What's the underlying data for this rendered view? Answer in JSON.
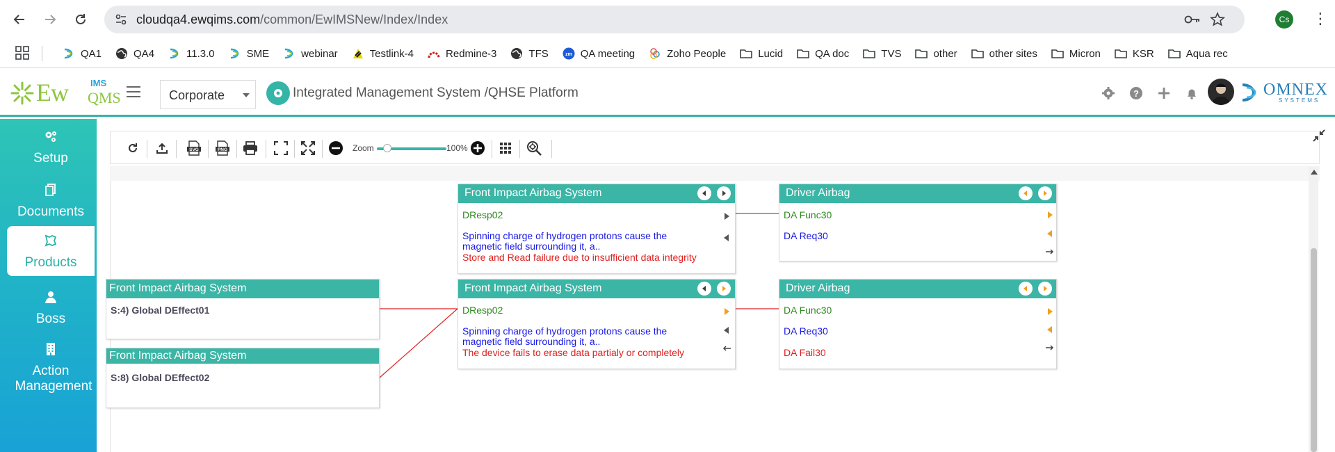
{
  "browser": {
    "url_host": "cloudqa4.ewqims.com",
    "url_path": "/common/EwIMSNew/Index/Index",
    "profile_initials": "Cs",
    "bookmarks": [
      {
        "label": "QA1",
        "icon": "ewqims-icon"
      },
      {
        "label": "QA4",
        "icon": "globe-icon"
      },
      {
        "label": "11.3.0",
        "icon": "ewqims-icon"
      },
      {
        "label": "SME",
        "icon": "ewqims-icon"
      },
      {
        "label": "webinar",
        "icon": "ewqims-icon"
      },
      {
        "label": "Testlink-4",
        "icon": "testlink-icon"
      },
      {
        "label": "Redmine-3",
        "icon": "redmine-icon"
      },
      {
        "label": "TFS",
        "icon": "globe-icon"
      },
      {
        "label": "QA meeting",
        "icon": "zoom-icon"
      },
      {
        "label": "Zoho People",
        "icon": "zoho-icon"
      },
      {
        "label": "Lucid",
        "icon": "folder-icon"
      },
      {
        "label": "QA doc",
        "icon": "folder-icon"
      },
      {
        "label": "TVS",
        "icon": "folder-icon"
      },
      {
        "label": "other",
        "icon": "folder-icon"
      },
      {
        "label": "other sites",
        "icon": "folder-icon"
      },
      {
        "label": "Micron",
        "icon": "folder-icon"
      },
      {
        "label": "KSR",
        "icon": "folder-icon"
      },
      {
        "label": "Aqua rec",
        "icon": "folder-icon"
      }
    ]
  },
  "header": {
    "logo_main": "Ew",
    "logo_ims": "IMS",
    "logo_qms": "QMS",
    "corporate_select": "Corporate",
    "platform_title": "Integrated Management System /QHSE Platform",
    "brand_name": "OMNEX",
    "brand_sub": "SYSTEMS"
  },
  "sidebar": {
    "items": [
      {
        "label": "Setup"
      },
      {
        "label": "Documents"
      },
      {
        "label": "Products",
        "active": true
      },
      {
        "label": "Boss"
      },
      {
        "label": "Action",
        "label2": "Management"
      }
    ]
  },
  "toolbar": {
    "zoom_label": "Zoom",
    "zoom_percent": "100%",
    "zoom_level": 0.15
  },
  "diagram": {
    "cards": [
      {
        "title": "Front Impact Airbag System",
        "line1": "DResp02",
        "line2": "Spinning charge of hydrogen protons cause the",
        "line3": "magnetic field surrounding it, a..",
        "line4": "Store and Read failure due to insufficient data integrity"
      },
      {
        "title": "Driver Airbag",
        "line1": "DA Func30",
        "line2": "DA Req30"
      },
      {
        "title": "Front Impact Airbag System",
        "line1": "DResp02",
        "line2": "Spinning charge of hydrogen protons cause the",
        "line3": "magnetic field surrounding it, a..",
        "line4": "The device fails to erase data partialy or completely"
      },
      {
        "title": "Driver Airbag",
        "line1": "DA Func30",
        "line2": "DA Req30",
        "line3": "DA Fail30"
      },
      {
        "title": "Front Impact Airbag System",
        "line1": "S:4) Global DEffect01"
      },
      {
        "title": "Front Impact Airbag System",
        "line1": "S:8) Global DEffect02"
      }
    ]
  },
  "colors": {
    "teal": "#3bb5a6",
    "func_green": "#2e8b1f",
    "req_blue": "#1a1ae6",
    "fail_red": "#e02020",
    "link_green": "#2e8b1f",
    "link_red": "#e02020"
  }
}
